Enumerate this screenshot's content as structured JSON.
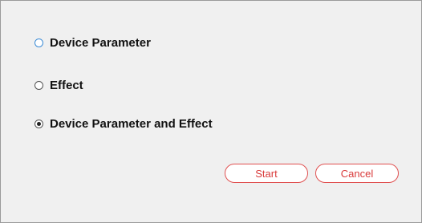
{
  "options": [
    {
      "label": "Device Parameter",
      "checked": false,
      "focused": true
    },
    {
      "label": "Effect",
      "checked": false,
      "focused": false
    },
    {
      "label": "Device Parameter and Effect",
      "checked": true,
      "focused": false
    }
  ],
  "buttons": {
    "start_label": "Start",
    "cancel_label": "Cancel"
  },
  "colors": {
    "button_accent": "#d93a3a",
    "focus_ring": "#3c8cd6",
    "panel_background": "#f0f0f0"
  }
}
